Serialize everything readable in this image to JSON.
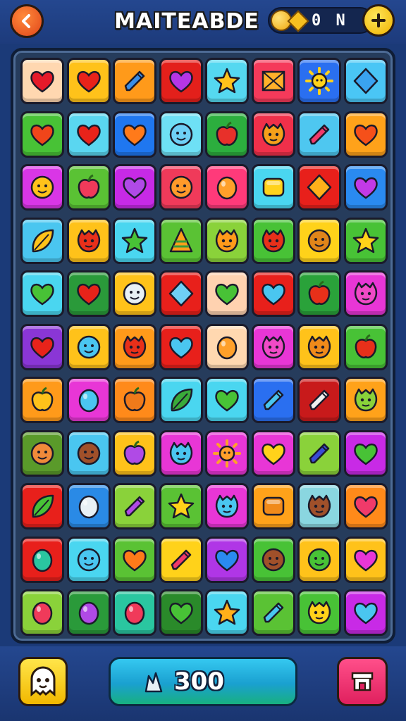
{
  "header": {
    "title": "MAITEABDE",
    "currency_value": "0 N",
    "back_icon": "arrow-left-icon",
    "add_icon": "plus-icon"
  },
  "board": {
    "columns": 8,
    "rows": 11,
    "tiles": [
      {
        "bg": "#ffd7b0",
        "icon": "heart",
        "color": "#e51a2a"
      },
      {
        "bg": "#ffc21a",
        "icon": "heart",
        "color": "#e8231a"
      },
      {
        "bg": "#ff9a1a",
        "icon": "pencil",
        "color": "#3a8ee6"
      },
      {
        "bg": "#e3201b",
        "icon": "heart",
        "color": "#b536e6"
      },
      {
        "bg": "#55d8f0",
        "icon": "star",
        "color": "#ffc21a"
      },
      {
        "bg": "#f53a5a",
        "icon": "envelope",
        "color": "#ffb02a"
      },
      {
        "bg": "#2a6ff0",
        "icon": "sun",
        "color": "#ffd21a"
      },
      {
        "bg": "#4ac6f5",
        "icon": "gem",
        "color": "#3aa3f0"
      },
      {
        "bg": "#48c236",
        "icon": "heart",
        "color": "#f0451a"
      },
      {
        "bg": "#5ad6f0",
        "icon": "heart",
        "color": "#e8231a"
      },
      {
        "bg": "#1f77f0",
        "icon": "heart",
        "color": "#ff7a1a"
      },
      {
        "bg": "#6ee0f5",
        "icon": "face",
        "color": "#6fd0f5"
      },
      {
        "bg": "#2cae3e",
        "icon": "apple",
        "color": "#e8302a"
      },
      {
        "bg": "#f0304a",
        "icon": "monster",
        "color": "#f5a01a"
      },
      {
        "bg": "#4ec7f0",
        "icon": "pencil",
        "color": "#f03a6a"
      },
      {
        "bg": "#ffa21a",
        "icon": "heart",
        "color": "#f5501a"
      },
      {
        "bg": "#d936e6",
        "icon": "face",
        "color": "#ffc21a"
      },
      {
        "bg": "#5ac234",
        "icon": "apple",
        "color": "#f03a5a"
      },
      {
        "bg": "#c72ae6",
        "icon": "heart",
        "color": "#b04ae6"
      },
      {
        "bg": "#f03a5a",
        "icon": "face",
        "color": "#ff9a2a"
      },
      {
        "bg": "#ff3a7a",
        "icon": "drop",
        "color": "#ffa02a"
      },
      {
        "bg": "#4ad6f0",
        "icon": "cube",
        "color": "#ffd21a"
      },
      {
        "bg": "#e8201b",
        "icon": "gem",
        "color": "#ffb01a"
      },
      {
        "bg": "#2a8af0",
        "icon": "heart",
        "color": "#c23ae6"
      },
      {
        "bg": "#4ac6f0",
        "icon": "leaf",
        "color": "#ffc21a"
      },
      {
        "bg": "#ffc21a",
        "icon": "monster",
        "color": "#e8301a"
      },
      {
        "bg": "#4ad6f0",
        "icon": "star",
        "color": "#48c236"
      },
      {
        "bg": "#5ac234",
        "icon": "pyramid",
        "color": "#ffa01a"
      },
      {
        "bg": "#8ad23a",
        "icon": "monster",
        "color": "#ff9a1a"
      },
      {
        "bg": "#48c236",
        "icon": "monster",
        "color": "#e8301a"
      },
      {
        "bg": "#ffd21a",
        "icon": "face",
        "color": "#e0851a"
      },
      {
        "bg": "#48c236",
        "icon": "star",
        "color": "#ffd21a"
      },
      {
        "bg": "#4ad6f0",
        "icon": "heart",
        "color": "#48c236"
      },
      {
        "bg": "#2a9a3a",
        "icon": "heart",
        "color": "#e8231a"
      },
      {
        "bg": "#ffc21a",
        "icon": "face",
        "color": "#e8f0f5"
      },
      {
        "bg": "#e8201b",
        "icon": "gem",
        "color": "#6fd0f5"
      },
      {
        "bg": "#ffd2b0",
        "icon": "heart",
        "color": "#48c236"
      },
      {
        "bg": "#e8201b",
        "icon": "heart",
        "color": "#4ac6f0"
      },
      {
        "bg": "#2aa23a",
        "icon": "apple",
        "color": "#e8301a"
      },
      {
        "bg": "#e836d6",
        "icon": "monster",
        "color": "#f04ac6"
      },
      {
        "bg": "#8a36d6",
        "icon": "heart",
        "color": "#e8231a"
      },
      {
        "bg": "#ffc21a",
        "icon": "face",
        "color": "#4ac6f0"
      },
      {
        "bg": "#ff9a1a",
        "icon": "monster",
        "color": "#e8301a"
      },
      {
        "bg": "#e8201b",
        "icon": "heart",
        "color": "#4ac6f0"
      },
      {
        "bg": "#ffd8b0",
        "icon": "drop",
        "color": "#ffa02a"
      },
      {
        "bg": "#e836d6",
        "icon": "monster",
        "color": "#f04ac6"
      },
      {
        "bg": "#ffc21a",
        "icon": "monster",
        "color": "#f08a1a"
      },
      {
        "bg": "#48c236",
        "icon": "apple",
        "color": "#e8301a"
      },
      {
        "bg": "#ff9a1a",
        "icon": "apple",
        "color": "#ffc21a"
      },
      {
        "bg": "#e836d6",
        "icon": "drop",
        "color": "#4ac6f0"
      },
      {
        "bg": "#ff8a1a",
        "icon": "apple",
        "color": "#f07a1a"
      },
      {
        "bg": "#4ad6f0",
        "icon": "leaf",
        "color": "#3aaa3a"
      },
      {
        "bg": "#4ad6f0",
        "icon": "heart",
        "color": "#48c236"
      },
      {
        "bg": "#2a6ff0",
        "icon": "pencil",
        "color": "#4ac6f0"
      },
      {
        "bg": "#c81a1b",
        "icon": "pencil",
        "color": "#f0f0f0"
      },
      {
        "bg": "#ffa21a",
        "icon": "monster",
        "color": "#8ad23a"
      },
      {
        "bg": "#5a9a2a",
        "icon": "face",
        "color": "#f08a3a"
      },
      {
        "bg": "#4ac6f0",
        "icon": "face",
        "color": "#a0502a"
      },
      {
        "bg": "#ffc21a",
        "icon": "apple",
        "color": "#b04ae6"
      },
      {
        "bg": "#e836d6",
        "icon": "monster",
        "color": "#4ac6f0"
      },
      {
        "bg": "#e836d6",
        "icon": "sun",
        "color": "#ffa02a"
      },
      {
        "bg": "#e836d6",
        "icon": "heart",
        "color": "#ffd21a"
      },
      {
        "bg": "#8ad23a",
        "icon": "pencil",
        "color": "#3a4ad6"
      },
      {
        "bg": "#c82ae6",
        "icon": "heart",
        "color": "#48c236"
      },
      {
        "bg": "#e8201b",
        "icon": "leaf",
        "color": "#48c236"
      },
      {
        "bg": "#2a8ae6",
        "icon": "drop",
        "color": "#e8f0f5"
      },
      {
        "bg": "#8ad23a",
        "icon": "pencil",
        "color": "#b04ae6"
      },
      {
        "bg": "#5ac234",
        "icon": "star",
        "color": "#ffd21a"
      },
      {
        "bg": "#e836d6",
        "icon": "monster",
        "color": "#4ac6f0"
      },
      {
        "bg": "#ffa21a",
        "icon": "cube",
        "color": "#f08a1a"
      },
      {
        "bg": "#8ad6e0",
        "icon": "monster",
        "color": "#a0502a"
      },
      {
        "bg": "#ff8a1a",
        "icon": "heart",
        "color": "#f03a6a"
      },
      {
        "bg": "#e8201b",
        "icon": "drop",
        "color": "#2ac6a0"
      },
      {
        "bg": "#4ad6f0",
        "icon": "face",
        "color": "#4ac6f0"
      },
      {
        "bg": "#5ac234",
        "icon": "heart",
        "color": "#ff7a1a"
      },
      {
        "bg": "#ffd21a",
        "icon": "pencil",
        "color": "#f03a6a"
      },
      {
        "bg": "#b036e6",
        "icon": "heart",
        "color": "#2a8af0"
      },
      {
        "bg": "#48c236",
        "icon": "face",
        "color": "#a0502a"
      },
      {
        "bg": "#ffc21a",
        "icon": "face",
        "color": "#48c236"
      },
      {
        "bg": "#ffc21a",
        "icon": "heart",
        "color": "#e836d6"
      },
      {
        "bg": "#8ad23a",
        "icon": "drop",
        "color": "#f03a5a"
      },
      {
        "bg": "#2a9a3a",
        "icon": "drop",
        "color": "#b04ae6"
      },
      {
        "bg": "#2ac6a0",
        "icon": "drop",
        "color": "#f03a5a"
      },
      {
        "bg": "#2a8a2a",
        "icon": "heart",
        "color": "#48c236"
      },
      {
        "bg": "#4ad6f0",
        "icon": "star",
        "color": "#ffb01a"
      },
      {
        "bg": "#5ac234",
        "icon": "pencil",
        "color": "#4ac6f0"
      },
      {
        "bg": "#48c236",
        "icon": "monster",
        "color": "#ffd21a"
      },
      {
        "bg": "#c82ae6",
        "icon": "heart",
        "color": "#4ac6f0"
      }
    ]
  },
  "footer": {
    "character_icon": "ghost-face-icon",
    "score_icon": "crystal-icon",
    "score_value": "300",
    "shop_icon": "shop-icon"
  }
}
